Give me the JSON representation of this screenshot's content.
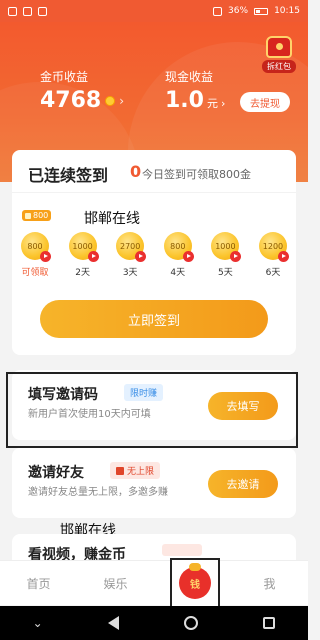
{
  "status_bar": {
    "time": "10:15",
    "battery": "36%"
  },
  "header": {
    "coin_label": "金币收益",
    "coin_value": "4768",
    "cash_label": "现金收益",
    "cash_value": "1.0",
    "cash_unit": "元",
    "withdraw_button": "去提现",
    "hongbao_label": "拆红包"
  },
  "signin": {
    "title": "已连续签到",
    "count": "0",
    "hint": "今日签到可领取800金",
    "bubble": "800",
    "watermark": "邯郸在线",
    "days": [
      {
        "coins": "800",
        "label": "可领取"
      },
      {
        "coins": "1000",
        "label": "2天"
      },
      {
        "coins": "2700",
        "label": "3天"
      },
      {
        "coins": "800",
        "label": "4天"
      },
      {
        "coins": "1000",
        "label": "5天"
      },
      {
        "coins": "1200",
        "label": "6天"
      }
    ],
    "button": "立即签到"
  },
  "tasks": [
    {
      "name": "填写邀请码",
      "tag": "限时赚",
      "desc": "新用户首次使用10天内可填",
      "button": "去填写"
    },
    {
      "name": "邀请好友",
      "tag": "无上限",
      "desc": "邀请好友总量无上限，多邀多赚",
      "button": "去邀请"
    },
    {
      "name": "看视频，赚金币"
    }
  ],
  "watermark2": "邯郸在线",
  "nav": {
    "home": "首页",
    "entertainment": "娱乐",
    "center_icon": "money-bag",
    "center_char": "钱",
    "me": "我"
  }
}
